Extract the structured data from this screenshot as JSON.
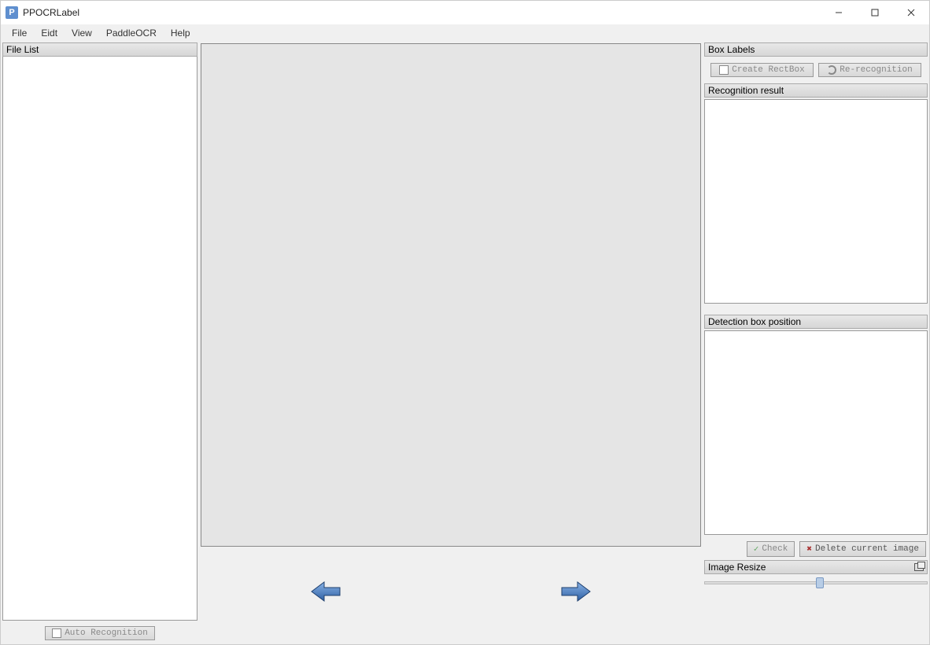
{
  "window": {
    "title": "PPOCRLabel"
  },
  "menu": {
    "items": [
      "File",
      "Eidt",
      "View",
      "PaddleOCR",
      "Help"
    ]
  },
  "left": {
    "title": "File List",
    "auto_recognition_label": "Auto Recognition"
  },
  "right": {
    "box_labels_title": "Box Labels",
    "create_rectbox_label": "Create RectBox",
    "re_recognition_label": "Re-recognition",
    "recognition_result_title": "Recognition result",
    "detection_box_title": "Detection box position",
    "check_label": "Check",
    "delete_label": "Delete current image",
    "image_resize_label": "Image Resize"
  }
}
